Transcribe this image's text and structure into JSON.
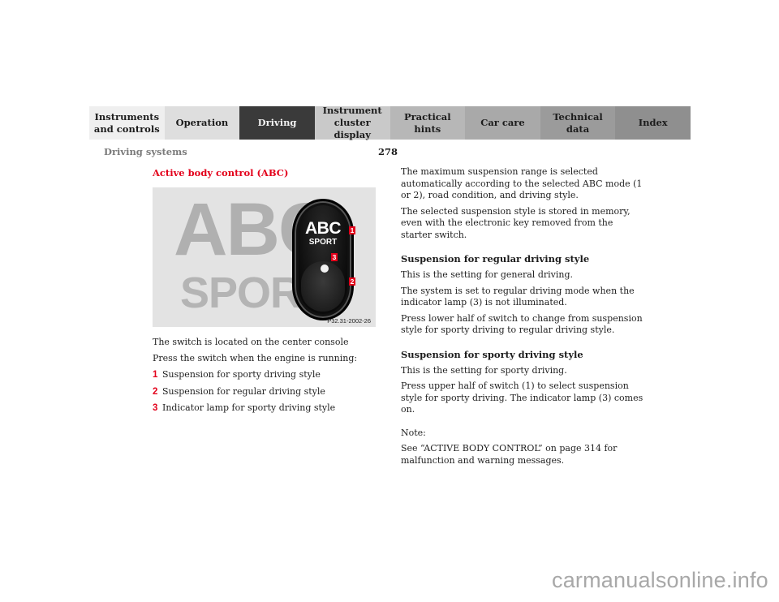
{
  "nav": {
    "tabs": [
      {
        "label": "Instruments\nand controls",
        "active": false
      },
      {
        "label": "Operation",
        "active": false
      },
      {
        "label": "Driving",
        "active": true
      },
      {
        "label": "Instrument\ncluster display",
        "active": false
      },
      {
        "label": "Practical hints",
        "active": false
      },
      {
        "label": "Car care",
        "active": false
      },
      {
        "label": "Technical\ndata",
        "active": false
      },
      {
        "label": "Index",
        "active": false
      }
    ]
  },
  "header": {
    "section": "Driving systems",
    "page_number": "278"
  },
  "left": {
    "title": "Active body control (ABC)",
    "figure": {
      "bg_text_top": "ABC",
      "bg_text_bottom": "SPORT",
      "switch_label_top": "ABC",
      "switch_label_bottom": "SPORT",
      "callouts": [
        "1",
        "2",
        "3"
      ],
      "code": "P32.31-2002-26"
    },
    "para1": "The switch is located on the center console",
    "para2": "Press the switch when the engine is running:",
    "items": [
      {
        "num": "1",
        "text": "Suspension for sporty driving style"
      },
      {
        "num": "2",
        "text": "Suspension for regular driving style"
      },
      {
        "num": "3",
        "text": "Indicator lamp for sporty driving style"
      }
    ]
  },
  "right": {
    "intro1": "The maximum suspension range is selected automatically according to the selected ABC mode (1 or 2), road condition, and driving style.",
    "intro2": "The selected suspension style is stored in memory, even with the electronic key removed from the starter switch.",
    "regular": {
      "heading": "Suspension for regular driving style",
      "p1": "This is the setting for general driving.",
      "p2": "The system is set to regular driving mode when the indicator lamp (3) is not illuminated.",
      "p3": "Press lower half of switch to change from suspension style for sporty driving to regular driving style."
    },
    "sporty": {
      "heading": "Suspension for sporty driving style",
      "p1": "This is the setting for sporty driving.",
      "p2": "Press upper half of switch (1) to select suspension style for sporty driving. The indicator lamp (3) comes on."
    },
    "note": {
      "label": "Note:",
      "text": "See “ACTIVE BODY CONTROL” on page 314 for malfunction and warning messages."
    }
  },
  "watermark": "carmanualsonline.info",
  "colors": {
    "accent_red": "#e3001b",
    "active_tab": "#3a3a3a"
  }
}
